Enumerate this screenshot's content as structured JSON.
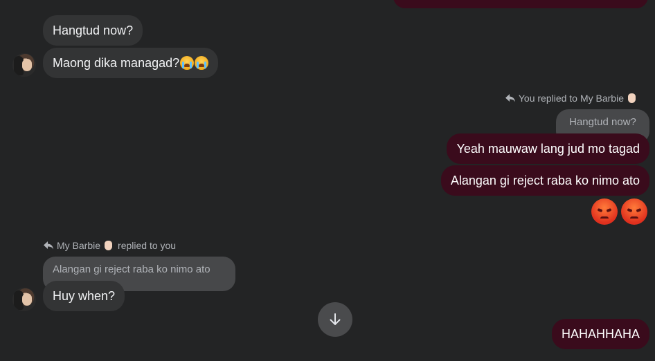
{
  "top_partial": {
    "color": "#3a0b1c"
  },
  "thread": {
    "incoming_group_1": [
      {
        "text": "Hangtud now?"
      },
      {
        "text": "Maong dika managad?"
      }
    ],
    "outgoing_reply": {
      "note_prefix": "You replied to",
      "note_name": "My Barbie",
      "quoted": "Hangtud now?",
      "messages": [
        {
          "text": "Yeah mauwaw lang jud mo tagad"
        },
        {
          "text": "Alangan gi reject raba ko nimo ato"
        }
      ],
      "emojis": [
        "angry-face",
        "angry-face"
      ]
    },
    "incoming_reply": {
      "note_name": "My Barbie",
      "note_suffix": "replied to you",
      "quoted": "Alangan gi reject raba ko nimo ato",
      "message": "Huy when?"
    },
    "last_outgoing": {
      "text": "HAHAHHAHA"
    }
  },
  "icons": {
    "reply": "reply-arrow-icon",
    "scroll_down": "arrow-down-icon",
    "crying": "crying-face-icon"
  },
  "colors": {
    "background": "#232425",
    "incoming": "#333435",
    "outgoing": "#3a0b1c",
    "quote": "#47484a"
  }
}
